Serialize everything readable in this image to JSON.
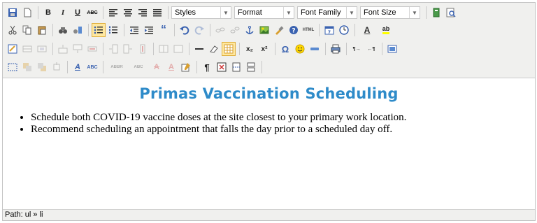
{
  "toolbar": {
    "row1": {
      "bold_label": "B",
      "italic_label": "I",
      "underline_label": "U",
      "strike_label": "ABC",
      "styles_label": "Styles",
      "format_label": "Format",
      "font_family_label": "Font Family",
      "font_size_label": "Font Size"
    },
    "row2": {
      "blockquote_label": "“",
      "html_label": "HTML",
      "forecolor_label": "A",
      "backcolor_label": "ab"
    },
    "row3": {
      "subscript_label": "x₂",
      "superscript_label": "x²",
      "omega_label": "Ω",
      "ltr_label": "¶→",
      "rtl_label": "←¶"
    },
    "row4": {
      "styleprops_label": "A",
      "spellcheck_label": "ABC",
      "abbr_label": "ABBR",
      "del_label": "A",
      "ins_label": "A",
      "pilcrow_label": "¶"
    }
  },
  "document": {
    "heading": "Primas Vaccination Scheduling",
    "list_items": [
      "Schedule both COVID-19 vaccine doses at the site closest to your primary work location.",
      "Recommend scheduling an appointment that falls the day prior to a scheduled day off."
    ]
  },
  "statusbar": {
    "path": "Path: ul » li"
  },
  "colors": {
    "heading": "#2e8bc9",
    "toolbar_bg": "#f0f0ee",
    "active_button": "#ffe8a0"
  }
}
